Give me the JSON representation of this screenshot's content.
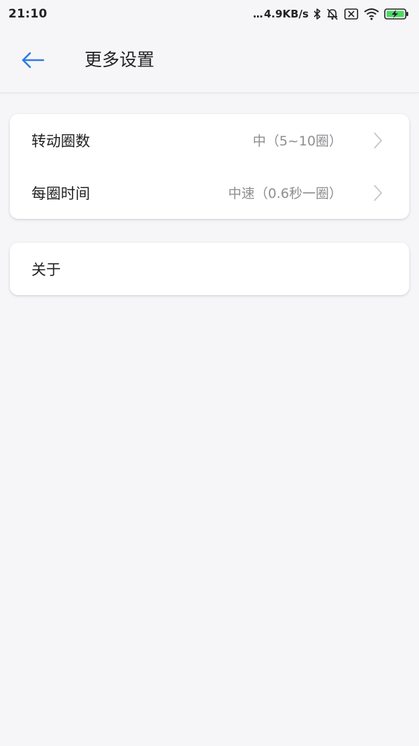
{
  "status_bar": {
    "time": "21:10",
    "dots": "...",
    "net_speed": "4.9KB/s",
    "icons": [
      "bluetooth-icon",
      "mute-icon",
      "sim-off-icon",
      "wifi-icon",
      "battery-charging-icon"
    ],
    "battery_color": "#4cd964"
  },
  "app_bar": {
    "title": "更多设置",
    "back_icon": "arrow-left-icon",
    "accent": "#2d7be5"
  },
  "settings": {
    "rotation_count": {
      "label": "转动圈数",
      "value": "中（5~10圈）"
    },
    "lap_time": {
      "label": "每圈时间",
      "value": "中速（0.6秒一圈）"
    }
  },
  "about": {
    "label": "关于"
  }
}
